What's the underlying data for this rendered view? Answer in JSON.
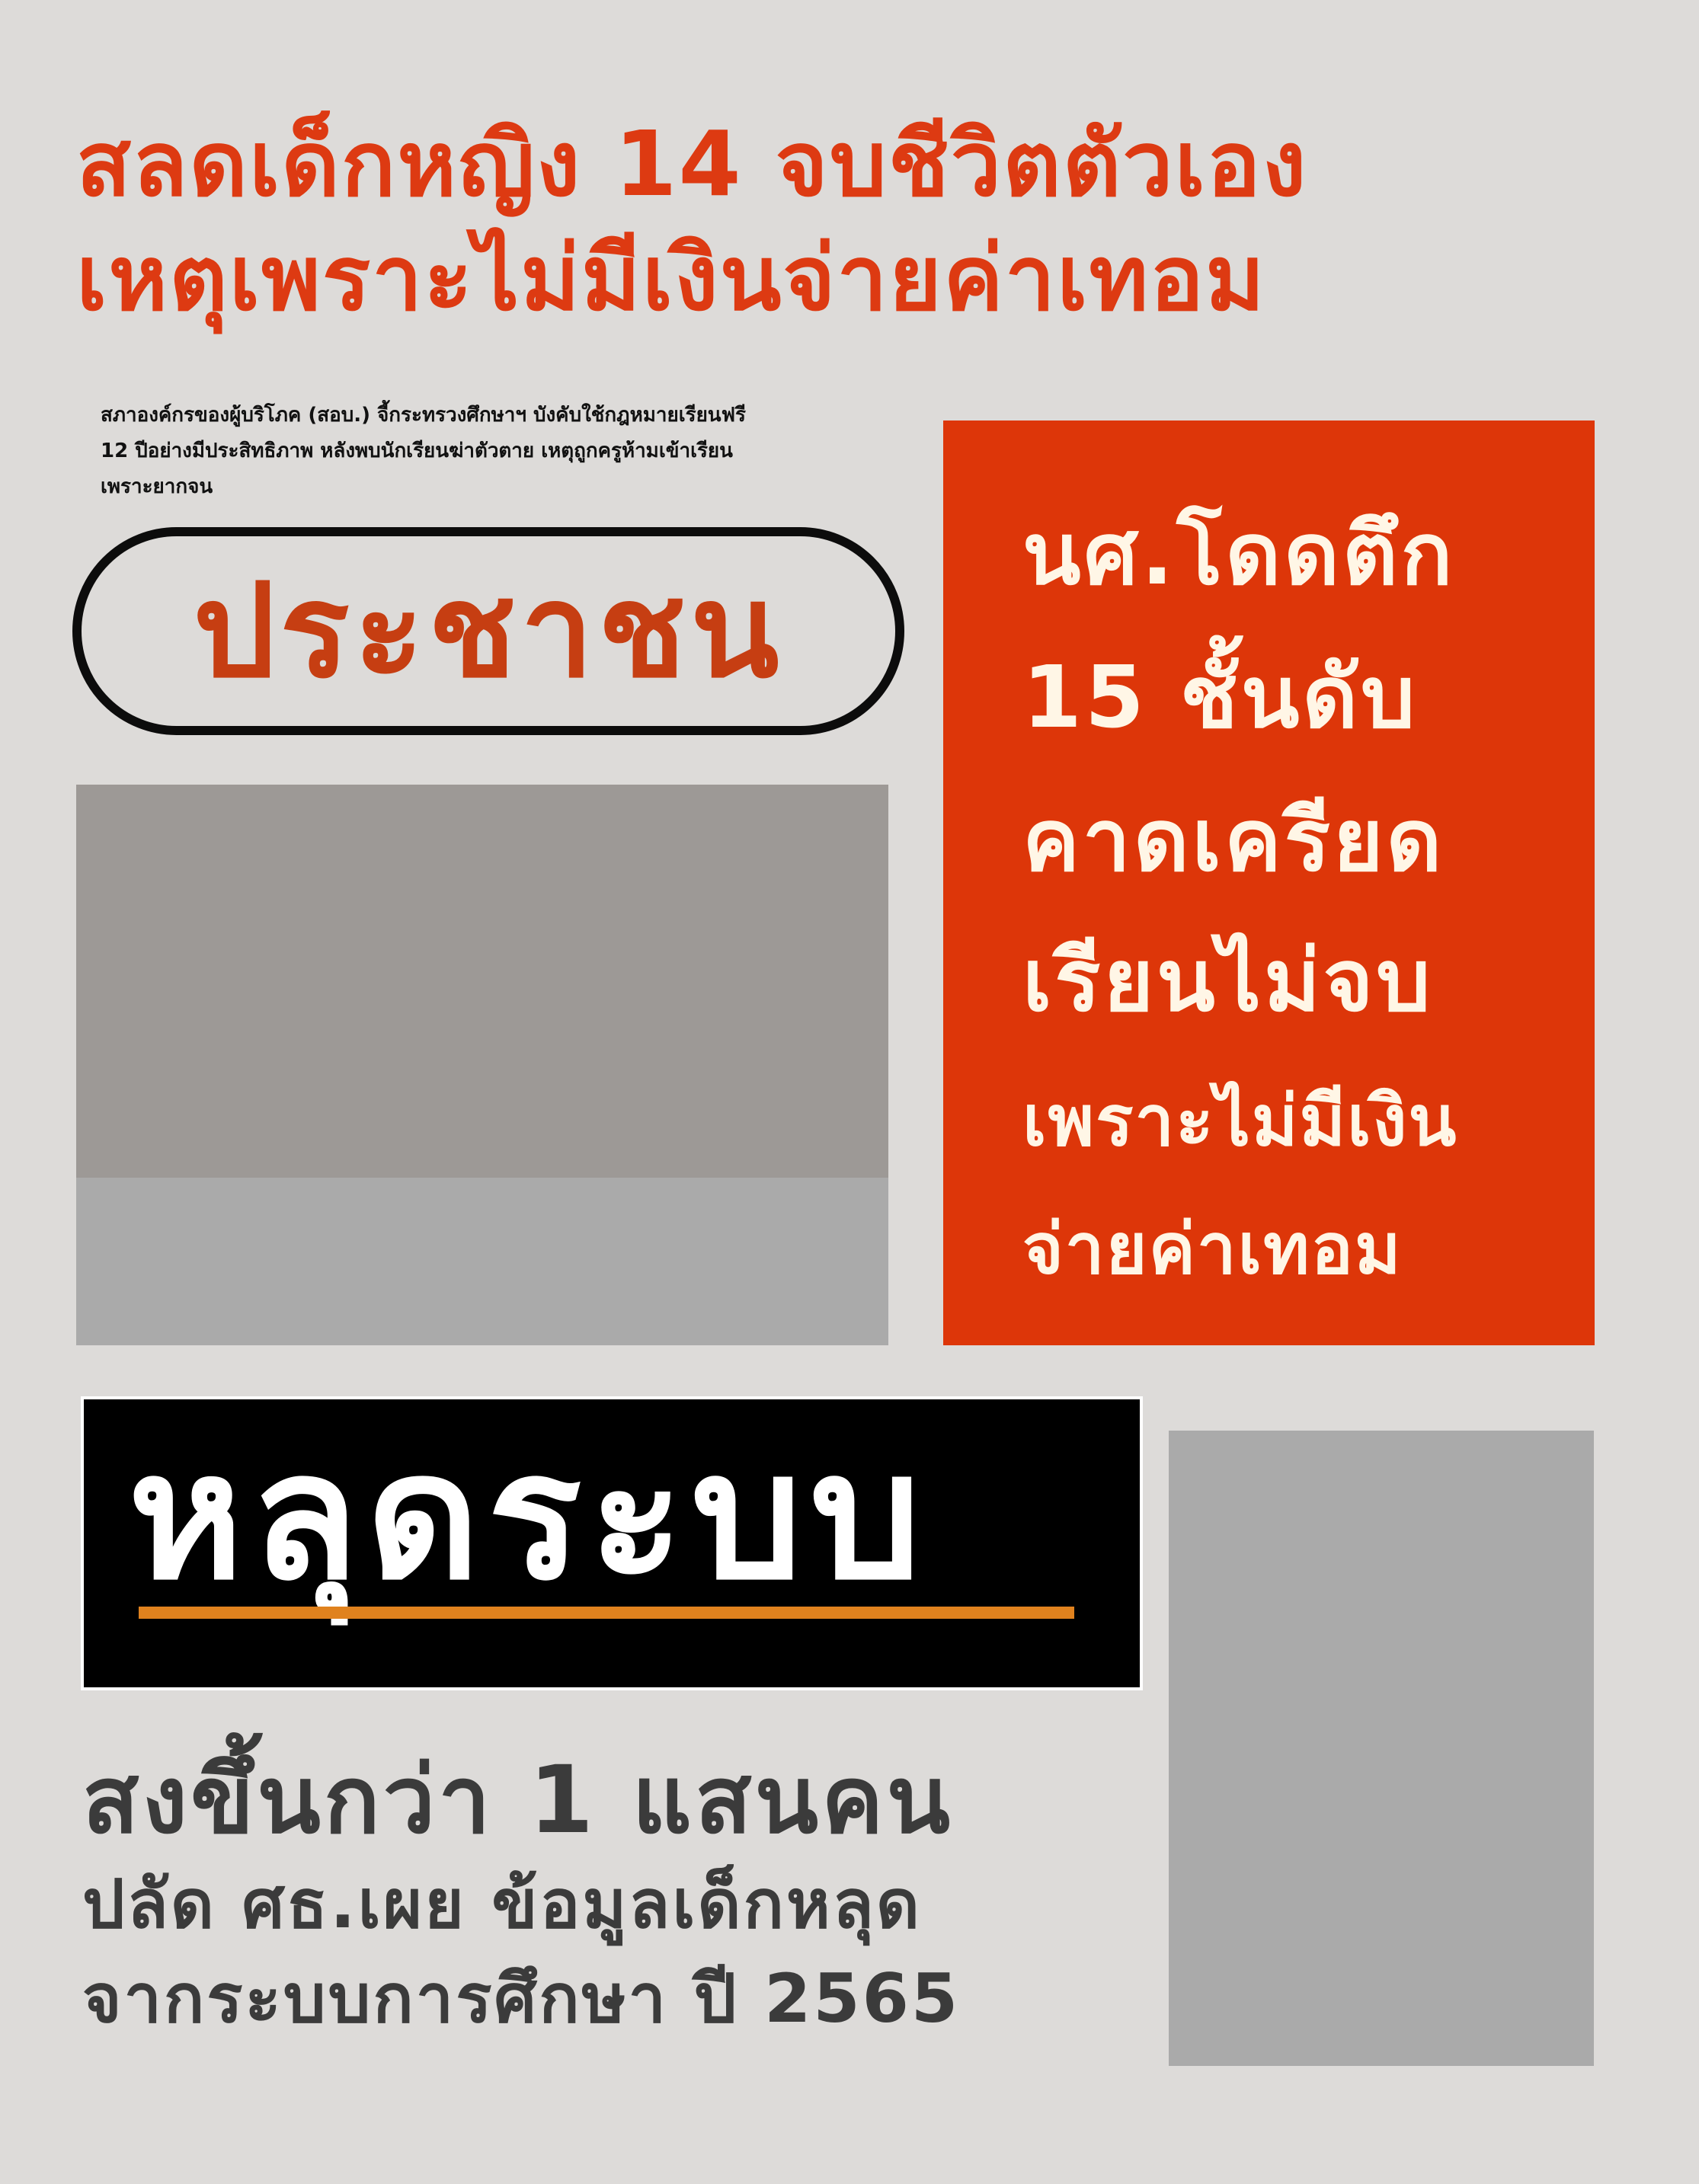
{
  "headline": {
    "line1": "สลดเด็กหญิง 14 จบชีวิตตัวเอง",
    "line2": "เหตุเพราะไม่มีเงินจ่ายค่าเทอม",
    "color": "#dd3a12"
  },
  "summary": {
    "line1": "สภาองค์กรของผู้บริโภค (สอบ.) จี้กระทรวงศึกษาฯ บังคับใช้กฎหมายเรียนฟรี",
    "line2": "12 ปีอย่างมีประสิทธิภาพ หลังพบนักเรียนฆ่าตัวตาย เหตุถูกครูห้ามเข้าเรียน",
    "line3": "เพราะยากจน"
  },
  "masthead": {
    "title": "ประชาชน",
    "color": "#c63e12"
  },
  "side_box": {
    "line1": "นศ.โดดตึก",
    "line2": "15 ชั้นดับ",
    "line3": "คาดเครียด",
    "line4": "เรียนไม่จบ",
    "line5": "เพราะไม่มีเงิน",
    "line6": "จ่ายค่าเทอม",
    "background": "#dd3609"
  },
  "black_label": {
    "title": "หลุดระบบ",
    "underline_color": "#e0821e"
  },
  "lower": {
    "line1": "สงขึ้นกว่า 1 แสนคน",
    "line2": "ปลัด ศธ.เผย ข้อมูลเด็กหลุด",
    "line3": "จากระบบการศึกษา ปี 2565"
  }
}
